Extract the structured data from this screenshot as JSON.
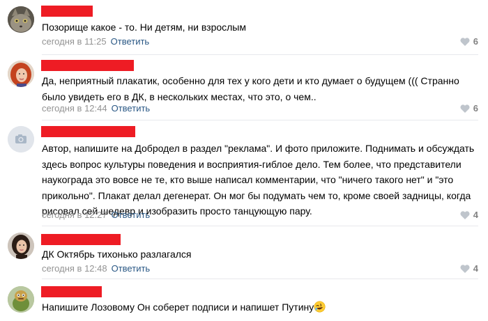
{
  "comments": [
    {
      "text": "Позорище какое - то. Ни детям, ни взрослым",
      "time": "сегодня в 11:25",
      "reply": "Ответить",
      "likes": "6",
      "avatar": "cat-photo"
    },
    {
      "text": "Да, неприятный плакатик, особенно для тех у кого дети и кто думает о будущем ((( Странно было увидеть его в ДК, в нескольких местах, что это, о чем..",
      "time": "сегодня в 12:44",
      "reply": "Ответить",
      "likes": "6",
      "avatar": "red-haired-woman-photo"
    },
    {
      "text": "Автор, напишите на Добродел в раздел \"реклама\". И фото приложите. Поднимать и обсуждать здесь вопрос культуры поведения и восприятия-гиблое дело. Тем более, что представители наукограда это вовсе не те, кто выше написал комментарии, что \"ничего такого нет\" и \"это прикольно\". Плакат делал дегенерат. Он мог бы подумать чем то, кроме своей задницы, когда рисовал сей шедевр и изобразить просто танцующую пару.",
      "time": "сегодня в 12:27",
      "reply": "Ответить",
      "likes": "4",
      "avatar": "camera-placeholder"
    },
    {
      "text": "ДК Октябрь тихонько разлагался",
      "time": "сегодня в 12:48",
      "reply": "Ответить",
      "likes": "4",
      "avatar": "dark-haired-woman-photo"
    },
    {
      "text": "Напишите Лозовому Он соберет подписи и напишет Путину",
      "emoji": "rolling-on-floor-laughing",
      "avatar": "cartoon-character-photo"
    }
  ],
  "colors": {
    "redacted_name": "#ee1c24",
    "reply_link": "#2a5885",
    "meta_text": "#939393",
    "divider": "#e7e8ec"
  }
}
